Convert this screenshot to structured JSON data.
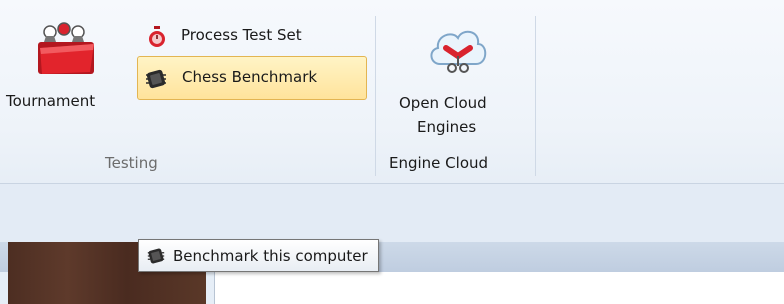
{
  "ribbon": {
    "testing_group": {
      "tournament_label": "Tournament",
      "process_test_set_label": "Process Test Set",
      "chess_benchmark_label": "Chess Benchmark",
      "group_label": "Testing"
    },
    "engine_cloud_group": {
      "open_cloud_engines_line1": "Open Cloud",
      "open_cloud_engines_line2": "Engines",
      "group_label": "Engine Cloud"
    }
  },
  "tooltip": {
    "text": "Benchmark this computer"
  },
  "icons": {
    "tournament": "folder-with-chess-pieces-icon",
    "process_test_set": "stopwatch-icon",
    "chess_benchmark": "chip-icon",
    "open_cloud_engines": "cloud-engines-icon"
  },
  "colors": {
    "highlight": "#ffe39b",
    "highlight_border": "#e3b552",
    "accent_red": "#d9232e"
  }
}
